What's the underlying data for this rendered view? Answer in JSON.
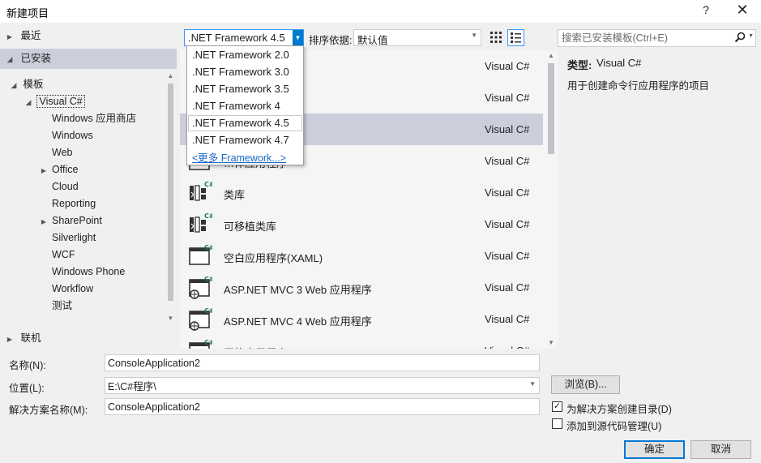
{
  "window": {
    "title": "新建项目",
    "help": "?",
    "close": "✕"
  },
  "left_panel": {
    "recent": "最近",
    "installed": "已安装",
    "templates": "模板",
    "visual_csharp": "Visual C#",
    "items": [
      {
        "label": "Windows 应用商店",
        "expandable": false
      },
      {
        "label": "Windows",
        "expandable": false
      },
      {
        "label": "Web",
        "expandable": false
      },
      {
        "label": "Office",
        "expandable": true
      },
      {
        "label": "Cloud",
        "expandable": false
      },
      {
        "label": "Reporting",
        "expandable": false
      },
      {
        "label": "SharePoint",
        "expandable": true
      },
      {
        "label": "Silverlight",
        "expandable": false
      },
      {
        "label": "WCF",
        "expandable": false
      },
      {
        "label": "Windows Phone",
        "expandable": false
      },
      {
        "label": "Workflow",
        "expandable": false
      },
      {
        "label": "测试",
        "expandable": false
      }
    ],
    "online": "联机"
  },
  "toolbar": {
    "framework_selected": ".NET Framework 4.5",
    "sort_label": "排序依据:",
    "sort_value": "默认值"
  },
  "framework_dropdown": {
    "options": [
      ".NET Framework 2.0",
      ".NET Framework 3.0",
      ".NET Framework 3.5",
      ".NET Framework 4",
      ".NET Framework 4.5",
      ".NET Framework 4.7"
    ],
    "current_index": 4,
    "more": "<更多 Framework...>"
  },
  "search": {
    "placeholder": "搜索已安装模板(Ctrl+E)"
  },
  "templates": [
    {
      "name": "…程序",
      "lang": "Visual C#",
      "icon": "console-app-icon",
      "selected": false
    },
    {
      "name": "",
      "lang": "Visual C#",
      "icon": "wpf-app-icon",
      "selected": false
    },
    {
      "name": "",
      "lang": "Visual C#",
      "icon": "console-app-icon",
      "selected": true
    },
    {
      "name": "…体应用程序",
      "lang": "Visual C#",
      "icon": "window-app-icon",
      "selected": false
    },
    {
      "name": "类库",
      "lang": "Visual C#",
      "icon": "class-library-icon",
      "selected": false
    },
    {
      "name": "可移植类库",
      "lang": "Visual C#",
      "icon": "portable-library-icon",
      "selected": false
    },
    {
      "name": "空白应用程序(XAML)",
      "lang": "Visual C#",
      "icon": "blank-app-icon",
      "selected": false
    },
    {
      "name": "ASP.NET MVC 3 Web 应用程序",
      "lang": "Visual C#",
      "icon": "web-app-icon",
      "selected": false
    },
    {
      "name": "ASP.NET MVC 4 Web 应用程序",
      "lang": "Visual C#",
      "icon": "web-app-icon",
      "selected": false
    },
    {
      "name": "网格应用程序(XAML)",
      "lang": "Visual C#",
      "icon": "grid-app-icon",
      "selected": false
    }
  ],
  "description": {
    "type_label": "类型:",
    "type_value": "Visual C#",
    "text": "用于创建命令行应用程序的项目"
  },
  "form": {
    "name_label": "名称(N):",
    "name_value": "ConsoleApplication2",
    "location_label": "位置(L):",
    "location_value": "E:\\C#程序\\",
    "solution_label": "解决方案名称(M):",
    "solution_value": "ConsoleApplication2",
    "browse": "浏览(B)...",
    "create_dir_label": "为解决方案创建目录(D)",
    "create_dir_checked": true,
    "source_control_label": "添加到源代码管理(U)",
    "source_control_checked": false,
    "ok": "确定",
    "cancel": "取消"
  },
  "colors": {
    "selection": "#cccedb",
    "accent": "#007acc",
    "link": "#1a6ac4"
  }
}
